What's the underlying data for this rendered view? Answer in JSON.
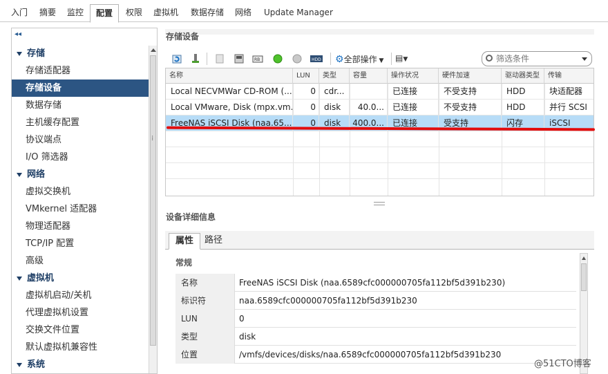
{
  "top_tabs": [
    {
      "label": "入门",
      "active": false
    },
    {
      "label": "摘要",
      "active": false
    },
    {
      "label": "监控",
      "active": false
    },
    {
      "label": "配置",
      "active": true
    },
    {
      "label": "权限",
      "active": false
    },
    {
      "label": "虚拟机",
      "active": false
    },
    {
      "label": "数据存储",
      "active": false
    },
    {
      "label": "网络",
      "active": false
    },
    {
      "label": "Update Manager",
      "active": false
    }
  ],
  "nav": {
    "collapse_glyph": "◂◂",
    "sections": [
      {
        "label": "存储",
        "items": [
          "存储适配器",
          "存储设备",
          "数据存储",
          "主机缓存配置",
          "协议端点",
          "I/O 筛选器"
        ]
      },
      {
        "label": "网络",
        "items": [
          "虚拟交换机",
          "VMkernel 适配器",
          "物理适配器",
          "TCP/IP 配置",
          "高级"
        ]
      },
      {
        "label": "虚拟机",
        "items": [
          "虚拟机启动/关机",
          "代理虚拟机设置",
          "交换文件位置",
          "默认虚拟机兼容性"
        ]
      },
      {
        "label": "系统",
        "items": []
      }
    ],
    "selected": "存储设备"
  },
  "storage_devices": {
    "title": "存储设备",
    "toolbar": {
      "all_actions": "全部操作",
      "filter_placeholder": "筛选条件",
      "icons": [
        "refresh-icon",
        "attach-icon",
        "detach-icon",
        "disk-icon",
        "device-icon",
        "green-circle-icon",
        "gray-circle-icon",
        "hdd-icon",
        "gear-icon",
        "export-icon"
      ]
    },
    "columns": [
      "名称",
      "LUN",
      "类型",
      "容量",
      "操作状况",
      "硬件加速",
      "驱动器类型",
      "传输"
    ],
    "rows": [
      {
        "name": "Local NECVMWar CD-ROM (...",
        "lun": "0",
        "type": "cdr...",
        "capacity": "",
        "status": "已连接",
        "hw_accel": "不受支持",
        "drive_type": "HDD",
        "transport": "块适配器"
      },
      {
        "name": "Local VMware, Disk (mpx.vm...",
        "lun": "0",
        "type": "disk",
        "capacity": "40.0...",
        "status": "已连接",
        "hw_accel": "不受支持",
        "drive_type": "HDD",
        "transport": "并行 SCSI"
      },
      {
        "name": "FreeNAS iSCSI Disk (naa.65...",
        "lun": "0",
        "type": "disk",
        "capacity": "400.0...",
        "status": "已连接",
        "hw_accel": "受支持",
        "drive_type": "闪存",
        "transport": "iSCSI"
      }
    ],
    "selected_row": 2
  },
  "details": {
    "title": "设备详细信息",
    "tabs": [
      "属性",
      "路径"
    ],
    "section": "常规",
    "properties": [
      {
        "key": "名称",
        "value": "FreeNAS iSCSI Disk (naa.6589cfc000000705fa112bf5d391b230)"
      },
      {
        "key": "标识符",
        "value": "naa.6589cfc000000705fa112bf5d391b230"
      },
      {
        "key": "LUN",
        "value": "0"
      },
      {
        "key": "类型",
        "value": "disk"
      },
      {
        "key": "位置",
        "value": "/vmfs/devices/disks/naa.6589cfc000000705fa112bf5d391b230"
      }
    ]
  },
  "watermark": "@51CTO博客",
  "colors": {
    "nav_selected": "#2c5583",
    "row_selected": "#b7dcf7",
    "annotation": "#e30d0d"
  }
}
